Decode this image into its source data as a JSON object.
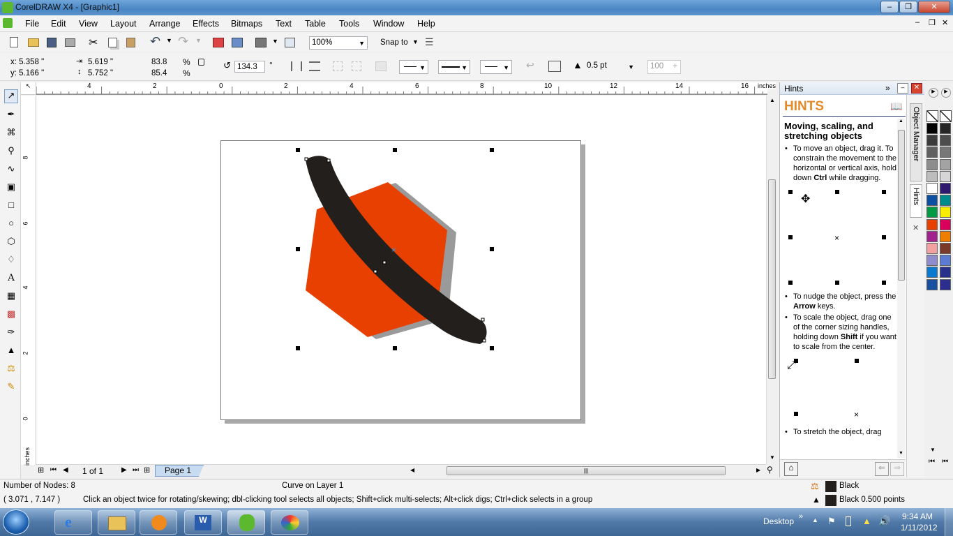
{
  "window": {
    "title": "CorelDRAW X4 - [Graphic1]"
  },
  "menu": [
    "File",
    "Edit",
    "View",
    "Layout",
    "Arrange",
    "Effects",
    "Bitmaps",
    "Text",
    "Table",
    "Tools",
    "Window",
    "Help"
  ],
  "standard_toolbar": {
    "zoom": "100%",
    "snap_to": "Snap to"
  },
  "property_bar": {
    "x": "x: 5.358 \"",
    "y": "y: 5.166 \"",
    "w": "5.619 \"",
    "h": "5.752 \"",
    "scale_w": "83.8",
    "scale_h": "85.4",
    "percent": "%",
    "rotation": "134.3",
    "degree": "°",
    "outline_width": "0.5 pt",
    "opacity": "100"
  },
  "ruler": {
    "unit": "inches",
    "top_ticks": [
      "4",
      "2",
      "0",
      "2",
      "4",
      "6",
      "8",
      "10",
      "12",
      "14",
      "16"
    ],
    "left_ticks": [
      "8",
      "6",
      "4",
      "2",
      "0"
    ]
  },
  "doc_nav": {
    "page_count": "1 of 1",
    "page_tab": "Page 1"
  },
  "hints": {
    "panel_title": "Hints",
    "heading": "HINTS",
    "subheading": "Moving, scaling, and stretching objects",
    "bullet1": {
      "a": "To move an object, drag it. To constrain the movement to the horizontal or vertical axis, hold down ",
      "b": "Ctrl",
      "c": " while dragging."
    },
    "bullet2": {
      "a": "To nudge the object, press the ",
      "b": "Arrow",
      "c": " keys."
    },
    "bullet3": {
      "a": "To scale the object, drag one of the corner sizing handles, holding down ",
      "b": "Shift",
      "c": " if you want to scale from the center."
    },
    "bullet4": "To stretch the object, drag",
    "side_tabs": [
      "Object Manager",
      "Hints"
    ]
  },
  "status": {
    "nodes": "Number of Nodes: 8",
    "layer": "Curve on Layer 1",
    "coords": "( 3.071 , 7.147 )",
    "tip": "Click an object twice for rotating/skewing; dbl-clicking tool selects all objects; Shift+click multi-selects; Alt+click digs; Ctrl+click selects in a group",
    "fill": "Black",
    "outline": "Black  0.500 points"
  },
  "taskbar": {
    "desktop": "Desktop",
    "time": "9:34 AM",
    "date": "1/11/2012"
  },
  "colors": {
    "orange": "#e84000",
    "black_shape": "#231f1c",
    "shadow": "#9a9a9a",
    "accent": "#e38a2a"
  },
  "palette": [
    "#000000",
    "#262626",
    "#3c3c3c",
    "#4d4d4d",
    "#616161",
    "#777777",
    "#8c8c8c",
    "#a3a3a3",
    "#bcbcbc",
    "#d6d6d6",
    "#ffffff",
    "#2e1a6e",
    "#0a4fa2",
    "#008c8c",
    "#009a44",
    "#f7ec00",
    "#e84000",
    "#d9005b",
    "#a3238e",
    "#ef7d00",
    "#f3a0a0",
    "#7a3a2a",
    "#8e8ccd",
    "#5a7bd0",
    "#0a7ad0",
    "#28318a",
    "#1a4fa0",
    "#2b2e8c"
  ]
}
